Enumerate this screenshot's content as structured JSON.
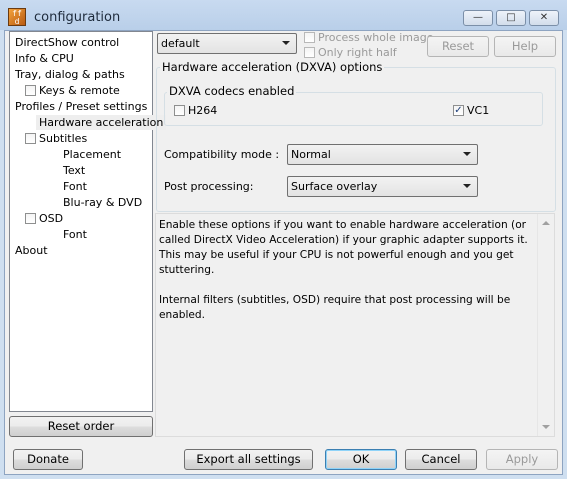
{
  "window": {
    "title": "configuration",
    "app_icon": "ffdshow-icon",
    "minimize": "minimize-icon",
    "maximize": "maximize-icon",
    "close": "close-icon"
  },
  "tree": {
    "items": [
      {
        "label": "DirectShow control",
        "checkbox": false,
        "indent": 0
      },
      {
        "label": "Info & CPU",
        "checkbox": false,
        "indent": 0
      },
      {
        "label": "Tray, dialog & paths",
        "checkbox": false,
        "indent": 0
      },
      {
        "label": "Keys & remote",
        "checkbox": true,
        "indent": 1
      },
      {
        "label": "Profiles / Preset settings",
        "checkbox": false,
        "indent": 0
      },
      {
        "label": "Hardware acceleration",
        "checkbox": false,
        "indent": 2,
        "selected": true
      },
      {
        "label": "Subtitles",
        "checkbox": true,
        "indent": 1
      },
      {
        "label": "Placement",
        "checkbox": false,
        "indent": 3
      },
      {
        "label": "Text",
        "checkbox": false,
        "indent": 3
      },
      {
        "label": "Font",
        "checkbox": false,
        "indent": 3
      },
      {
        "label": "Blu-ray & DVD",
        "checkbox": false,
        "indent": 3
      },
      {
        "label": "OSD",
        "checkbox": true,
        "indent": 1
      },
      {
        "label": "Font",
        "checkbox": false,
        "indent": 3
      },
      {
        "label": "About",
        "checkbox": false,
        "indent": 0
      }
    ],
    "reset_order": "Reset order"
  },
  "preset": {
    "value": "default"
  },
  "options": {
    "process_whole_image": "Process whole image",
    "only_right_half": "Only right half",
    "reset": "Reset",
    "help": "Help"
  },
  "hw": {
    "title": "Hardware acceleration (DXVA) options",
    "codecs_title": "DXVA codecs enabled",
    "h264": {
      "label": "H264",
      "checked": false
    },
    "vc1": {
      "label": "VC1",
      "checked": true
    },
    "compat_label": "Compatibility mode :",
    "compat_value": "Normal",
    "post_label": "Post processing:",
    "post_value": "Surface overlay"
  },
  "help_text": "Enable these options if you want to enable hardware acceleration (or called DirectX Video Acceleration) if your graphic adapter supports it. This may be useful if your CPU is not powerful enough and you get stuttering.\n\nInternal filters (subtitles, OSD) require that post processing will be enabled.",
  "footer": {
    "donate": "Donate",
    "export": "Export all settings",
    "ok": "OK",
    "cancel": "Cancel",
    "apply": "Apply"
  },
  "colors": {
    "title_bar": "#c8daf0",
    "dialog_bg": "#f0f0f0",
    "tree_bg": "#ffffff"
  }
}
